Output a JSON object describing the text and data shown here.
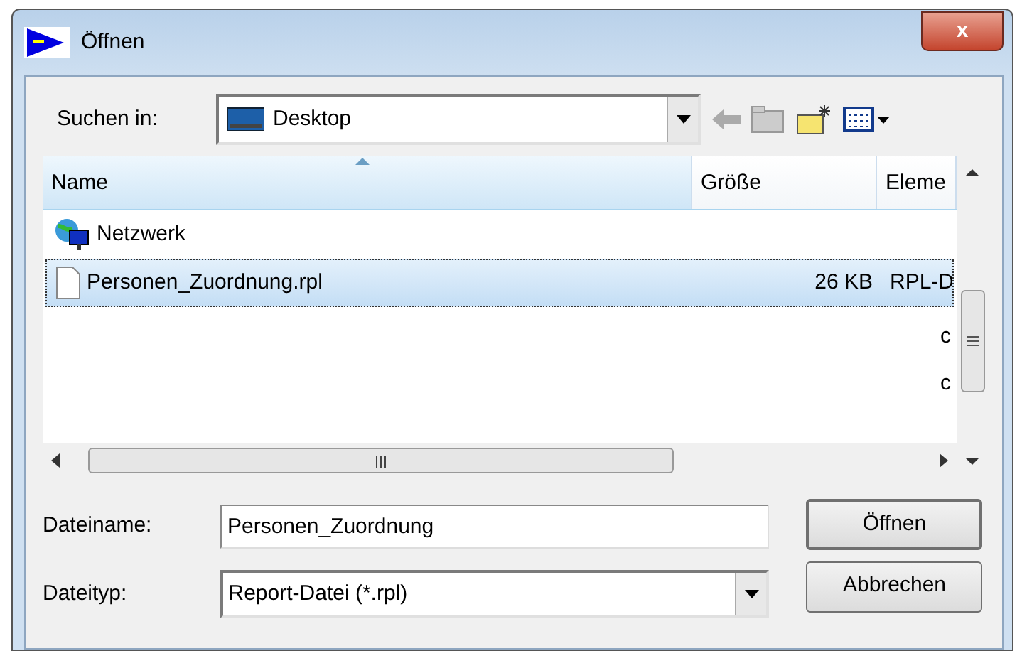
{
  "window": {
    "title": "Öffnen",
    "close_label": "x"
  },
  "look_in": {
    "label": "Suchen in:",
    "value": "Desktop"
  },
  "file_list": {
    "columns": [
      {
        "label": "Name",
        "sorted": true
      },
      {
        "label": "Größe",
        "sorted": false
      },
      {
        "label": "Eleme",
        "sorted": false
      }
    ],
    "rows": [
      {
        "kind": "network",
        "name": "Netzwerk",
        "selected": false
      },
      {
        "kind": "file",
        "name": "Personen_Zuordnung.rpl",
        "size": "26 KB",
        "type": "RPL-D",
        "selected": true
      }
    ],
    "overflow": [
      "c",
      "c"
    ]
  },
  "file_name": {
    "label": "Dateiname:",
    "value": "Personen_Zuordnung"
  },
  "file_type": {
    "label": "Dateityp:",
    "value": "Report-Datei (*.rpl)"
  },
  "buttons": [
    "Öffnen",
    "Abbrechen"
  ]
}
